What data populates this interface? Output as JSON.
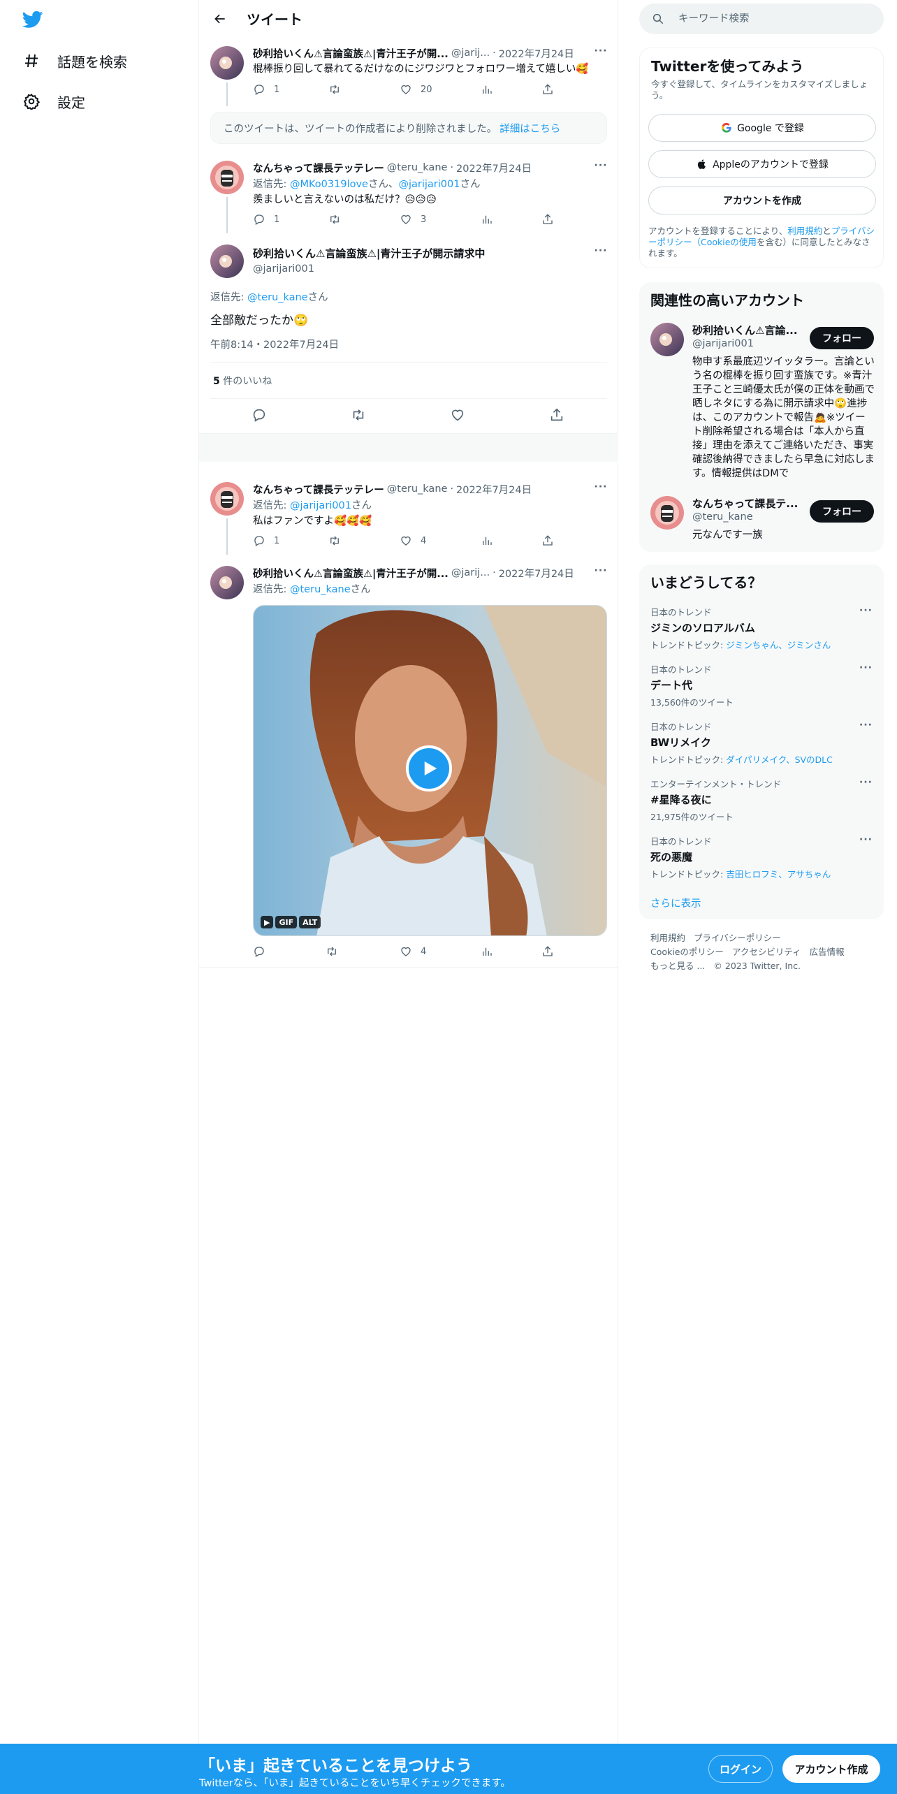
{
  "colors": {
    "accent": "#1d9bf0",
    "text": "#0f1419",
    "secondary": "#536471",
    "bottombar": "#1d9bf0"
  },
  "nav": {
    "logo": "twitter-bird-icon",
    "items": [
      {
        "icon": "hashtag-icon",
        "label": "話題を検索"
      },
      {
        "icon": "gear-icon",
        "label": "設定"
      }
    ]
  },
  "header": {
    "title": "ツイート"
  },
  "tweets": [
    {
      "name": "砂利拾いくん⚠言論蛮族⚠|青汁王子が開...",
      "handle": "@jarij...",
      "date": "2022年7月24日",
      "text": "棍棒振り回して暴れてるだけなのにジワジワとフォロワー増えて嬉しい🥰",
      "replies": "1",
      "retweets": "",
      "likes": "20"
    },
    {
      "name": "なんちゃって課長テッテレー",
      "handle": "@teru_kane",
      "date": "2022年7月24日",
      "reply_prefix": "返信先: ",
      "reply_to_1": "@MKo0319love",
      "reply_mid": "さん、",
      "reply_to_2": "@jarijari001",
      "reply_suffix": "さん",
      "text": "羨ましいと言えないのは私だけ？😥😥😥",
      "replies": "1",
      "retweets": "",
      "likes": "3"
    },
    {
      "name": "なんちゃって課長テッテレー",
      "handle": "@teru_kane",
      "date": "2022年7月24日",
      "reply_prefix": "返信先: ",
      "reply_to": "@jarijari001",
      "reply_suffix": "さん",
      "text": "私はファンですよ🥰🥰🥰",
      "replies": "1",
      "retweets": "",
      "likes": "4"
    },
    {
      "name": "砂利拾いくん⚠言論蛮族⚠|青汁王子が開...",
      "handle": "@jarij...",
      "date": "2022年7月24日",
      "reply_prefix": "返信先: ",
      "reply_to": "@teru_kane",
      "reply_suffix": "さん",
      "media_badges": [
        "GIF",
        "ALT"
      ],
      "replies": "",
      "retweets": "",
      "likes": "4"
    }
  ],
  "deleted_notice": {
    "text": "このツイートは、ツイートの作成者により削除されました。",
    "link": "詳細はこちら"
  },
  "focus": {
    "name": "砂利拾いくん⚠言論蛮族⚠|青汁王子が開示請求中",
    "handle": "@jarijari001",
    "reply_prefix": "返信先: ",
    "reply_to": "@teru_kane",
    "reply_suffix": "さん",
    "text": "全部敵だったか🙄",
    "timestamp": "午前8:14・2022年7月24日",
    "likes_count": "5",
    "likes_label": " 件のいいね"
  },
  "search": {
    "placeholder": "キーワード検索"
  },
  "signup_card": {
    "title": "Twitterを使ってみよう",
    "subtitle": "今すぐ登録して、タイムラインをカスタマイズしましょう。",
    "google": "Google で登録",
    "apple": "Appleのアカウントで登録",
    "create": "アカウントを作成",
    "terms_1": "アカウントを登録することにより、",
    "terms_link1": "利用規約",
    "terms_2": "と",
    "terms_link2": "プライバシーポリシー（Cookieの使用",
    "terms_3": "を含む）に同意したとみなされます。"
  },
  "related": {
    "title": "関連性の高いアカウント",
    "accounts": [
      {
        "name": "砂利拾いくん⚠言論...",
        "handle": "@jarijari001",
        "bio": "物申す系最底辺ツイッタラー。言論という名の棍棒を振り回す蛮族です。※青汁王子こと三崎優太氏が僕の正体を動画で晒しネタにする為に開示請求中🙄進捗は、このアカウントで報告🙇※ツイート削除希望される場合は「本人から直接」理由を添えてご連絡いただき、事実確認後納得できましたら早急に対応します。情報提供はDMで",
        "follow": "フォロー"
      },
      {
        "name": "なんちゃって課長テ...",
        "handle": "@teru_kane",
        "bio": "元なんです一族",
        "follow": "フォロー"
      }
    ]
  },
  "trends": {
    "title": "いまどうしてる？",
    "items": [
      {
        "category": "日本のトレンド",
        "name": "ジミンのソロアルバム",
        "meta_prefix": "トレンドトピック: ",
        "meta_link": "ジミンちゃん、ジミンさん"
      },
      {
        "category": "日本のトレンド",
        "name": "デート代",
        "meta_prefix": "13,560件のツイート",
        "meta_link": ""
      },
      {
        "category": "日本のトレンド",
        "name": "BWリメイク",
        "meta_prefix": "トレンドトピック: ",
        "meta_link": "ダイパリメイク、SVのDLC"
      },
      {
        "category": "エンターテインメント・トレンド",
        "name": "#星降る夜に",
        "meta_prefix": "21,975件のツイート",
        "meta_link": ""
      },
      {
        "category": "日本のトレンド",
        "name": "死の悪魔",
        "meta_prefix": "トレンドトピック: ",
        "meta_link": "吉田ヒロフミ、アサちゃん"
      }
    ],
    "show_more": "さらに表示"
  },
  "footer": {
    "links": [
      "利用規約",
      "プライバシーポリシー",
      "Cookieのポリシー",
      "アクセシビリティ",
      "広告情報",
      "もっと見る ..."
    ],
    "copyright": "© 2023 Twitter, Inc."
  },
  "bottom_bar": {
    "title": "「いま」起きていることを見つけよう",
    "subtitle": "Twitterなら、「いま」起きていることをいち早くチェックできます。",
    "login": "ログイン",
    "signup": "アカウント作成"
  }
}
